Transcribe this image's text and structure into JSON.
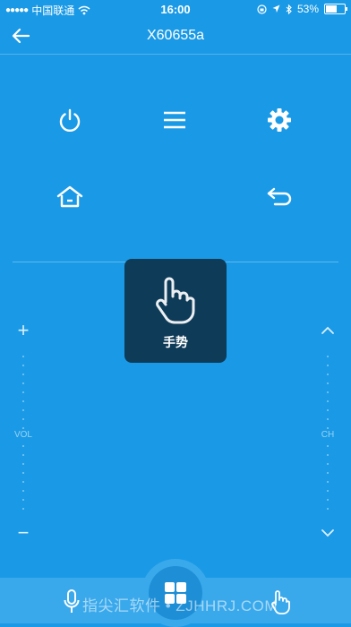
{
  "status_bar": {
    "carrier": "中国联通",
    "time": "16:00",
    "battery": "53%",
    "battery_level": 0.53
  },
  "nav": {
    "title": "X60655a"
  },
  "gesture_popup": {
    "label": "手势"
  },
  "volume": {
    "plus": "+",
    "label": "VOL",
    "minus": "−"
  },
  "channel": {
    "label": "CH"
  },
  "watermark": {
    "text": "指尖汇软件 • ZJHHRJ.COM"
  },
  "colors": {
    "background": "#1a9ae6",
    "popup": "#0e3b58",
    "bottom_bar": "#3aa9ec"
  }
}
